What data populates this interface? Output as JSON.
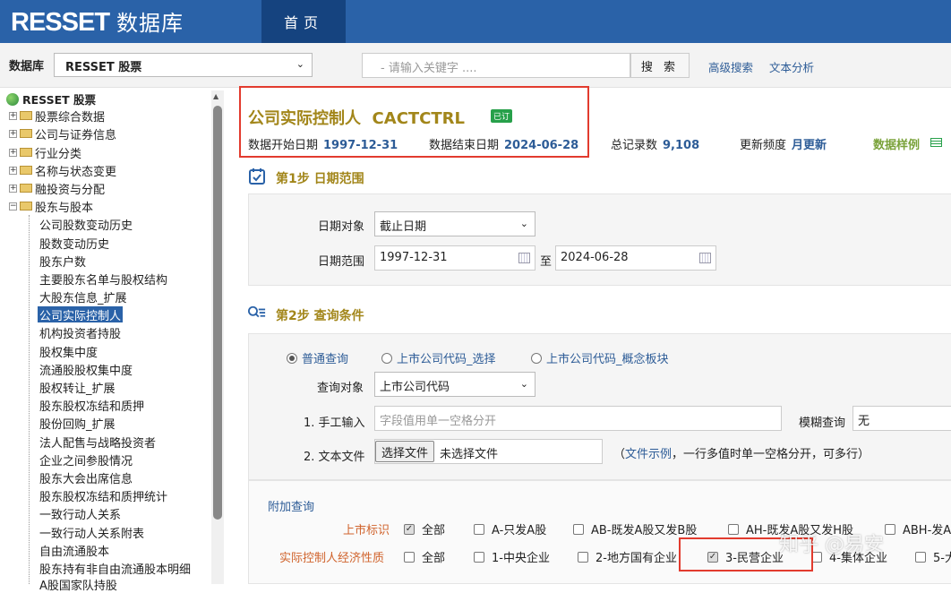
{
  "header": {
    "logo_en": "RESSET",
    "logo_cn": "数据库",
    "home_tab": "首页"
  },
  "search": {
    "db_label": "数据库",
    "db_selected": "RESSET 股票",
    "keyword_placeholder": "- 请输入关键字 ....",
    "search_button": "搜 索",
    "advanced_link": "高级搜索",
    "text_analysis_link": "文本分析"
  },
  "tree": {
    "root": "RESSET 股票",
    "folders": [
      "股票综合数据",
      "公司与证券信息",
      "行业分类",
      "名称与状态变更",
      "融投资与分配",
      "股东与股本"
    ],
    "leaves": [
      "公司股数变动历史",
      "股数变动历史",
      "股东户数",
      "主要股东名单与股权结构",
      "大股东信息_扩展",
      "公司实际控制人",
      "机构投资者持股",
      "股权集中度",
      "流通股股权集中度",
      "股权转让_扩展",
      "股东股权冻结和质押",
      "股份回购_扩展",
      "法人配售与战略投资者",
      "企业之间参股情况",
      "股东大会出席信息",
      "股东股权冻结和质押统计",
      "一致行动人关系",
      "一致行动人关系附表",
      "自由流通股本",
      "股东持有非自由流通股本明细",
      "A股国家队持股"
    ],
    "selected": "公司实际控制人"
  },
  "dataset": {
    "title": "公司实际控制人",
    "code": "CACTCTRL",
    "badge": "已订",
    "start_label": "数据开始日期",
    "start_value": "1997-12-31",
    "end_label": "数据结束日期",
    "end_value": "2024-06-28",
    "records_label": "总记录数",
    "records_value": "9,108",
    "freq_label": "更新频度",
    "freq_value": "月更新",
    "sample_link": "数据样例"
  },
  "step1": {
    "title": "第1步 日期范围",
    "date_object_label": "日期对象",
    "date_object_value": "截止日期",
    "date_range_label": "日期范围",
    "date_from": "1997-12-31",
    "to_label": "至",
    "date_to": "2024-06-28"
  },
  "step2": {
    "title": "第2步 查询条件",
    "radios": [
      "普通查询",
      "上市公司代码_选择",
      "上市公司代码_概念板块"
    ],
    "query_object_label": "查询对象",
    "query_object_value": "上市公司代码",
    "manual_label": "1. 手工输入",
    "manual_placeholder": "字段值用单一空格分开",
    "fuzzy_label": "模糊查询",
    "fuzzy_value": "无",
    "file_label": "2. 文本文件",
    "file_button": "选择文件",
    "file_status": "未选择文件",
    "file_hint_pre": "（",
    "file_hint_link": "文件示例",
    "file_hint_post": "，一行多值时单一空格分开，可多行）",
    "extra_title": "附加查询",
    "listing_label": "上市标识",
    "listing_options": [
      "全部",
      "A-只发A股",
      "AB-既发A股又发B股",
      "AH-既发A股又发H股",
      "ABH-发A"
    ],
    "owner_label": "实际控制人经济性质",
    "owner_options": [
      "全部",
      "1-中央企业",
      "2-地方国有企业",
      "3-民营企业",
      "4-集体企业",
      "5-大"
    ]
  },
  "watermark": "知乎 @易安"
}
